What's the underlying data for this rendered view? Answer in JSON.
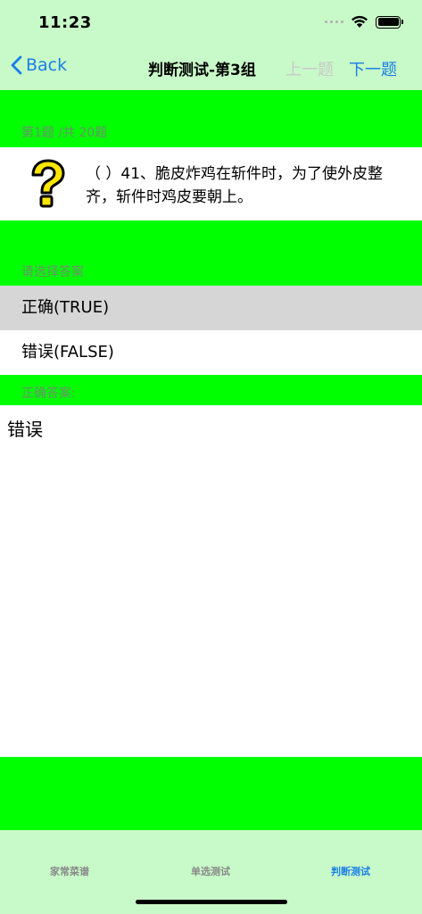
{
  "status_bar": {
    "time": "11:23"
  },
  "nav": {
    "back_label": "Back",
    "title": "判断测试-第3组",
    "prev_label": "上一题",
    "next_label": "下一题"
  },
  "question": {
    "counter": "第1题 /共 20题",
    "text": "（ ）41、脆皮炸鸡在斩件时，为了使外皮整齐，斩件时鸡皮要朝上。",
    "icon": "question-mark-icon"
  },
  "options": {
    "section_label": "请选择答案",
    "items": [
      {
        "label": "正确(TRUE)",
        "selected": true
      },
      {
        "label": "错误(FALSE)",
        "selected": false
      }
    ]
  },
  "answer": {
    "section_label": "正确答案:",
    "value": "错误"
  },
  "tab_bar": {
    "tabs": [
      {
        "label": "家常菜谱",
        "active": false
      },
      {
        "label": "单选测试",
        "active": false
      },
      {
        "label": "判断测试",
        "active": true
      }
    ]
  },
  "colors": {
    "accent": "#1a7fe8",
    "band": "#00ff00",
    "bar_background": "#c8f9c8",
    "selected_option": "#d6d6d6"
  }
}
